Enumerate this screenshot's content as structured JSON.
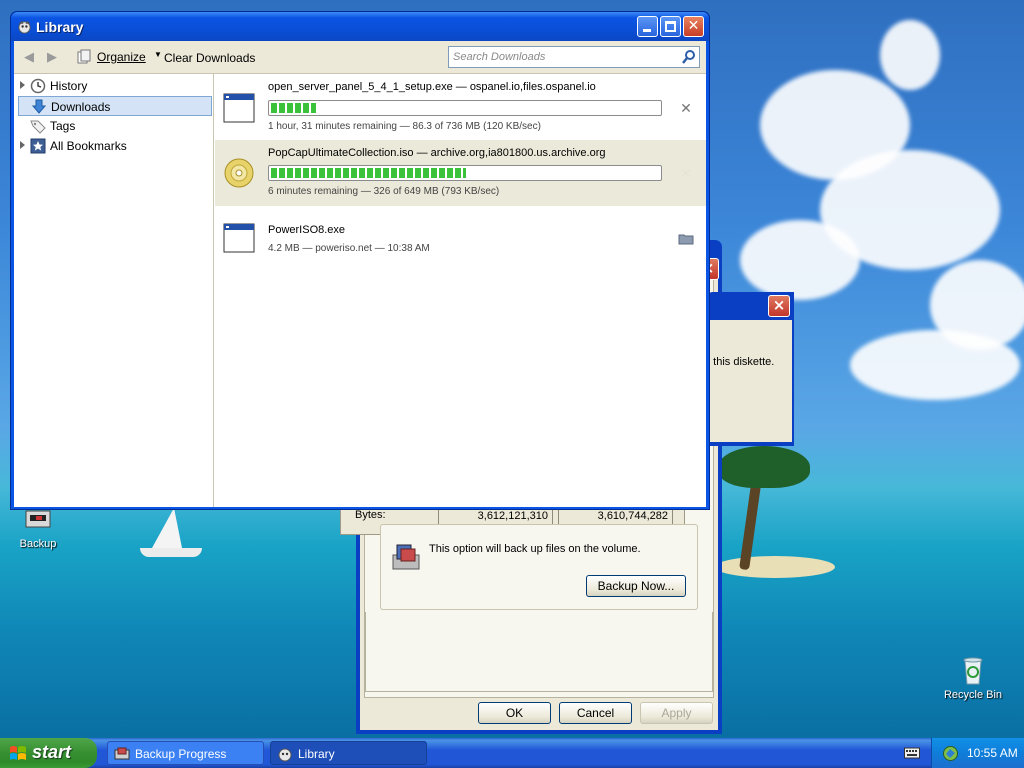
{
  "library": {
    "title": "Library",
    "toolbar": {
      "organize_label": "Organize",
      "clear_label": "Clear Downloads",
      "search_placeholder": "Search Downloads"
    },
    "sidebar": {
      "items": [
        {
          "label": "History",
          "icon": "clock-icon"
        },
        {
          "label": "Downloads",
          "icon": "download-arrow-icon",
          "selected": true
        },
        {
          "label": "Tags",
          "icon": "tag-icon"
        },
        {
          "label": "All Bookmarks",
          "icon": "bookmarks-star-icon"
        }
      ]
    },
    "downloads": [
      {
        "name": "open_server_panel_5_4_1_setup.exe — ospanel.io,files.ospanel.io",
        "status": "1 hour, 31 minutes remaining — 86.3 of 736 MB (120 KB/sec)",
        "progress": 0.117,
        "action_icon": "cancel-x-icon",
        "file_icon": "exe-window-icon"
      },
      {
        "name": "PopCapUltimateCollection.iso — archive.org,ia801800.us.archive.org",
        "status": "6 minutes remaining — 326 of 649 MB (793 KB/sec)",
        "progress": 0.502,
        "action_icon": "cancel-x-icon",
        "file_icon": "disc-icon"
      },
      {
        "name": "PowerISO8.exe",
        "status": "4.2 MB — poweriso.net — 10:38 AM",
        "action_icon": "open-folder-icon",
        "file_icon": "exe-window-icon"
      }
    ]
  },
  "backup": {
    "bytes_label": "Bytes:",
    "bytes_value_1": "3,612,121,310",
    "bytes_value_2": "3,610,744,282",
    "option_text": "This option will back up files on the volume.",
    "backup_now_label": "Backup Now...",
    "ok_label": "OK",
    "cancel_label": "Cancel",
    "apply_label": "Apply"
  },
  "diskette_dialog": {
    "text": "n this diskette."
  },
  "desktop": {
    "icons": [
      {
        "label": "Backup",
        "icon": "backup-icon"
      },
      {
        "label": "Recycle Bin",
        "icon": "recycle-bin-icon"
      }
    ]
  },
  "taskbar": {
    "start_label": "start",
    "tasks": [
      {
        "label": "Backup Progress",
        "icon": "backup-icon"
      },
      {
        "label": "Library",
        "icon": "firefox-library-icon"
      }
    ],
    "clock": "10:55 AM"
  },
  "colors": {
    "xp_blue": "#0b55e4",
    "progress_green": "#3bc23b",
    "selected_row": "#d4e4f6"
  }
}
